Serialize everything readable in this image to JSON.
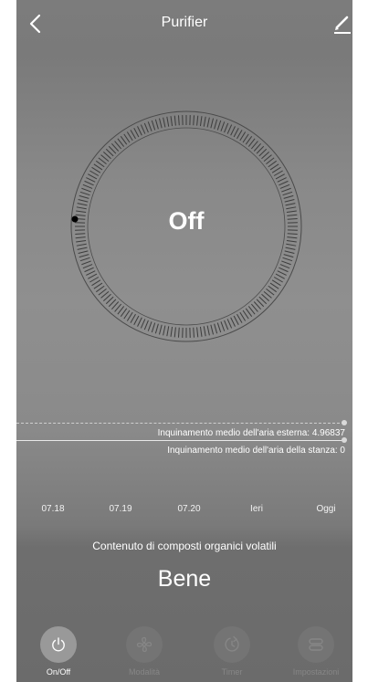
{
  "header": {
    "title": "Purifier",
    "back_icon": "chevron-left-icon",
    "edit_icon": "pencil-icon"
  },
  "dial": {
    "value": "Off"
  },
  "pollution": {
    "outdoor_label": "Inquinamento medio dell'aria esterna: 4.96837",
    "indoor_label": "Inquinamento medio dell'aria della stanza: 0"
  },
  "x_axis": [
    "07.18",
    "07.19",
    "07.20",
    "Ieri",
    "Oggi"
  ],
  "voc": {
    "title": "Contenuto di composti organici volatili",
    "value": "Bene"
  },
  "tabs": [
    {
      "label": "On/Off",
      "icon": "power-icon",
      "active": true
    },
    {
      "label": "Modalità",
      "icon": "fan-icon",
      "active": false
    },
    {
      "label": "Timer",
      "icon": "timer-icon",
      "active": false
    },
    {
      "label": "Impostazioni",
      "icon": "settings-icon",
      "active": false
    }
  ],
  "colors": {
    "background_top": "#7c7c7c",
    "background_bottom": "#6b6b6b",
    "text": "#ffffff",
    "active_tab": "#999999",
    "inactive_tab": "#747474"
  }
}
